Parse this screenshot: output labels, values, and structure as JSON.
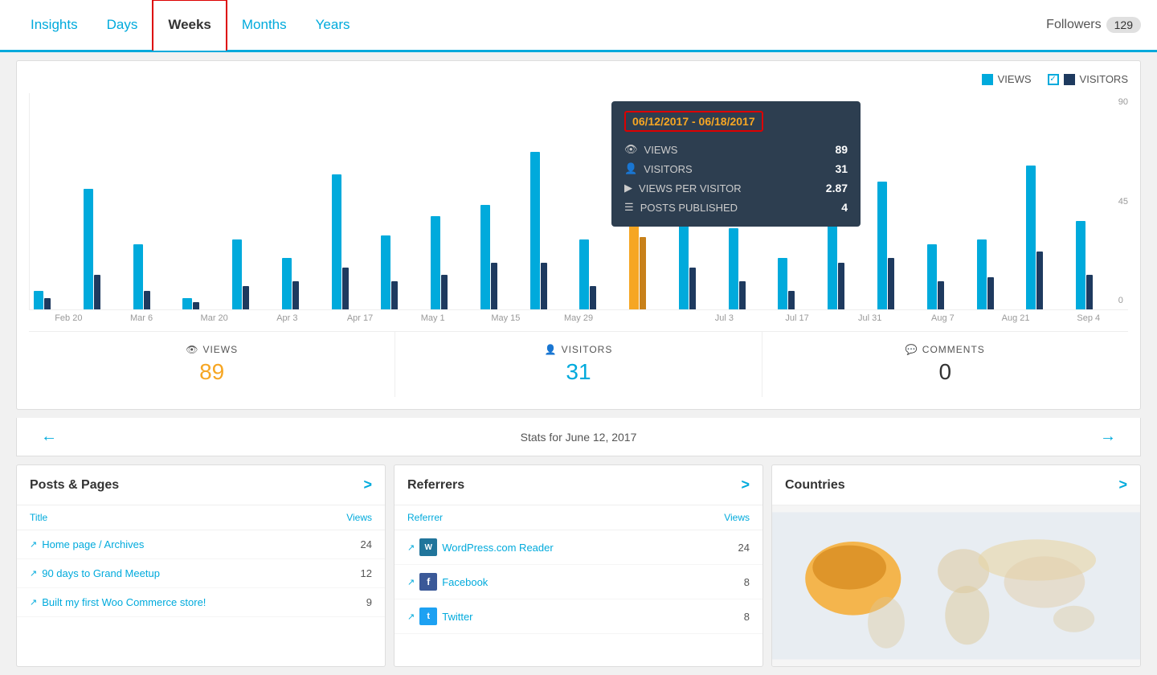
{
  "nav": {
    "tabs": [
      {
        "id": "insights",
        "label": "Insights",
        "active": false
      },
      {
        "id": "days",
        "label": "Days",
        "active": false
      },
      {
        "id": "weeks",
        "label": "Weeks",
        "active": true
      },
      {
        "id": "months",
        "label": "Months",
        "active": false
      },
      {
        "id": "years",
        "label": "Years",
        "active": false
      }
    ],
    "followers_label": "Followers",
    "followers_count": "129"
  },
  "chart": {
    "legend": {
      "views_label": "VIEWS",
      "visitors_label": "VISITORS"
    },
    "y_labels": [
      "90",
      "45",
      "0"
    ],
    "x_labels": [
      "Feb 20",
      "Mar 6",
      "Mar 20",
      "Apr 3",
      "Apr 17",
      "May 1",
      "May 15",
      "May 29",
      "",
      "Jul 3",
      "Jul 17",
      "Jul 31",
      "Aug 7",
      "Aug 21",
      "Sep 4"
    ],
    "bars": [
      {
        "views": 8,
        "visitors": 5,
        "highlight": false
      },
      {
        "views": 52,
        "visitors": 15,
        "highlight": false
      },
      {
        "views": 28,
        "visitors": 8,
        "highlight": false
      },
      {
        "views": 5,
        "visitors": 3,
        "highlight": false
      },
      {
        "views": 30,
        "visitors": 10,
        "highlight": false
      },
      {
        "views": 22,
        "visitors": 12,
        "highlight": false
      },
      {
        "views": 58,
        "visitors": 18,
        "highlight": false
      },
      {
        "views": 32,
        "visitors": 12,
        "highlight": false
      },
      {
        "views": 40,
        "visitors": 15,
        "highlight": false
      },
      {
        "views": 45,
        "visitors": 20,
        "highlight": false
      },
      {
        "views": 68,
        "visitors": 20,
        "highlight": false
      },
      {
        "views": 30,
        "visitors": 10,
        "highlight": false
      },
      {
        "views": 89,
        "visitors": 31,
        "highlight": true
      },
      {
        "views": 42,
        "visitors": 18,
        "highlight": false
      },
      {
        "views": 35,
        "visitors": 12,
        "highlight": false
      },
      {
        "views": 22,
        "visitors": 8,
        "highlight": false
      },
      {
        "views": 50,
        "visitors": 20,
        "highlight": false
      },
      {
        "views": 55,
        "visitors": 22,
        "highlight": false
      },
      {
        "views": 28,
        "visitors": 12,
        "highlight": false
      },
      {
        "views": 30,
        "visitors": 14,
        "highlight": false
      },
      {
        "views": 62,
        "visitors": 25,
        "highlight": false
      },
      {
        "views": 38,
        "visitors": 15,
        "highlight": false
      }
    ]
  },
  "stats": {
    "views_label": "VIEWS",
    "views_value": "89",
    "visitors_label": "VISITORS",
    "visitors_value": "31",
    "comments_label": "COMMENTS",
    "comments_value": "0"
  },
  "tooltip": {
    "date_range": "06/12/2017 - 06/18/2017",
    "views_label": "VIEWS",
    "views_value": "89",
    "visitors_label": "VISITORS",
    "visitors_value": "31",
    "vpp_label": "VIEWS PER VISITOR",
    "vpp_value": "2.87",
    "posts_label": "POSTS PUBLISHED",
    "posts_value": "4"
  },
  "nav_date": "Stats for June 12, 2017",
  "panels": {
    "posts": {
      "title": "Posts & Pages",
      "col_title": "Title",
      "col_views": "Views",
      "rows": [
        {
          "title": "Home page / Archives",
          "views": "24"
        },
        {
          "title": "90 days to Grand Meetup",
          "views": "12"
        },
        {
          "title": "Built my first Woo Commerce store!",
          "views": "9"
        }
      ]
    },
    "referrers": {
      "title": "Referrers",
      "col_referrer": "Referrer",
      "col_views": "Views",
      "rows": [
        {
          "title": "WordPress.com Reader",
          "icon": "wp",
          "views": "24"
        },
        {
          "title": "Facebook",
          "icon": "fb",
          "views": "8"
        },
        {
          "title": "Twitter",
          "icon": "tw",
          "views": "8"
        }
      ]
    },
    "countries": {
      "title": "Countries"
    }
  }
}
